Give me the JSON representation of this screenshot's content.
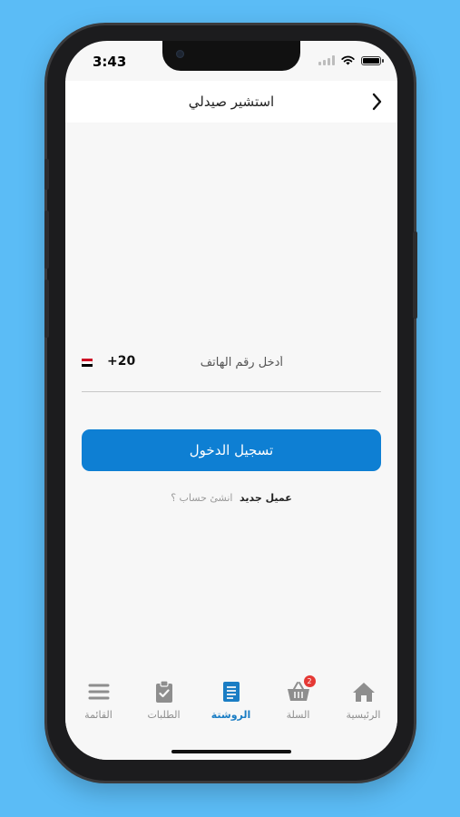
{
  "status_bar": {
    "time": "3:43"
  },
  "header": {
    "title": "استشير صيدلي",
    "back_icon": "chevron-right-icon"
  },
  "login": {
    "country_code": "+20",
    "phone_placeholder": "أدخل رقم الهاتف",
    "phone_value": "",
    "submit_label": "تسجيل الدخول",
    "new_customer_label": "عميل جديد",
    "create_account_link": "انشئ حساب ؟"
  },
  "tabbar": {
    "items": [
      {
        "label": "الرئيسية",
        "icon": "home-icon"
      },
      {
        "label": "السلة",
        "icon": "basket-icon",
        "badge": "2"
      },
      {
        "label": "الروشتة",
        "icon": "prescription-icon",
        "active": true
      },
      {
        "label": "الطلبات",
        "icon": "orders-clipboard-icon"
      },
      {
        "label": "القائمة",
        "icon": "menu-icon"
      }
    ]
  },
  "colors": {
    "background": "#5bbcf6",
    "primary": "#0e7fd3",
    "active_tab": "#1a7dc4",
    "badge": "#e53935"
  }
}
